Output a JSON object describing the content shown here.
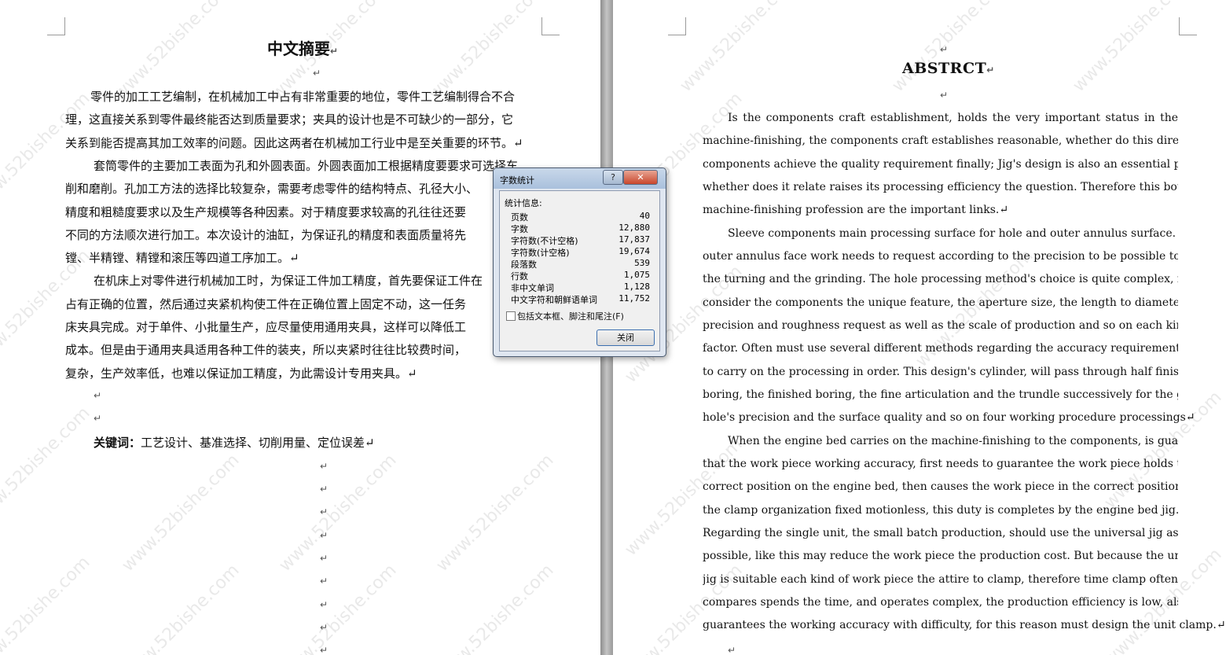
{
  "left_page": {
    "title": "中文摘要",
    "paragraph_mark": "↵",
    "lines": [
      "零件的加工工艺编制，在机械加工中占有非常重要的地位，零件工艺编制得合不合",
      "理，这直接关系到零件最终能否达到质量要求；夹具的设计也是不可缺少的一部分，它",
      "关系到能否提高其加工效率的问题。因此这两者在机械加工行业中是至关重要的环节。↵",
      "套筒零件的主要加工表面为孔和外圆表面。外圆表面加工根据精度要要求可选择车",
      "削和磨削。孔加工方法的选择比较复杂，需要考虑零件的结构特点、孔径大小、",
      "精度和粗糙度要求以及生产规模等各种因素。对于精度要求较高的孔往往还要",
      "不同的方法顺次进行加工。本次设计的油缸，为保证孔的精度和表面质量将先",
      "镗、半精镗、精镗和滚压等四道工序加工。↵",
      "在机床上对零件进行机械加工时，为保证工件加工精度，首先要保证工件在",
      "占有正确的位置，然后通过夹紧机构使工件在正确位置上固定不动，这一任务",
      "床夹具完成。对于单件、小批量生产，应尽量使用通用夹具，这样可以降低工",
      "成本。但是由于通用夹具适用各种工件的装夹，所以夹紧时往往比较费时间，",
      "复杂，生产效率低，也难以保证加工精度，为此需设计专用夹具。↵"
    ],
    "keywords_label": "关键词：",
    "keywords": "工艺设计、基准选择、切削用量、定位误差↵"
  },
  "right_page": {
    "title": "ABSTRCT",
    "lines": [
      "Is the components craft establishment, holds the very important status in the",
      "machine-finishing, the components craft establishes reasonable, whether do this direct relation",
      "components achieve the quality requirement finally; Jig's design is also an essential part,",
      "whether does it relate raises its processing efficiency the question. Therefore this both in the",
      "machine-finishing profession are the important links.↵",
      "Sleeve components main processing surface for hole and outer annulus surface. The",
      "outer annulus face work needs to request according to the precision to be possible to choose",
      "the turning and the grinding. The hole processing method's choice is quite complex, needs to",
      "consider the components the unique feature, the aperture size, the length to diameter ratio, the",
      "precision and roughness request as well as the scale of production and so on each kind of",
      "factor. Often must use several different methods regarding the accuracy requirement high hole",
      "to carry on the processing in order. This design's cylinder, will pass through half finished",
      "boring, the finished boring, the fine articulation and the trundle successively for the guarantee",
      "hole's precision and the surface quality and so on four working procedure processings↵",
      "When the engine bed carries on the machine-finishing to the components, is guaranteed",
      "that the work piece working accuracy, first needs to guarantee the work piece holds the",
      "correct position on the engine bed, then causes the work piece in the correct position through",
      "the clamp organization fixed motionless, this duty is completes by the engine bed jig.",
      "Regarding the single unit, the small batch production, should use the universal jig as far as",
      "possible, like this may reduce the work piece the production cost. But because the universal",
      "jig is suitable each kind of work piece the attire to clamp, therefore time clamp often",
      "compares spends the time, and operates complex, the production efficiency is low, also",
      "guarantees the working accuracy with difficulty, for this reason must design the unit clamp.↵"
    ]
  },
  "watermark": "www.52bishe.com",
  "dialog": {
    "title": "字数统计",
    "help": "?",
    "close_x": "✕",
    "group_label": "统计信息:",
    "stats": [
      {
        "label": "页数",
        "value": "40"
      },
      {
        "label": "字数",
        "value": "12,880"
      },
      {
        "label": "字符数(不计空格)",
        "value": "17,837"
      },
      {
        "label": "字符数(计空格)",
        "value": "19,674"
      },
      {
        "label": "段落数",
        "value": "539"
      },
      {
        "label": "行数",
        "value": "1,075"
      },
      {
        "label": "非中文单词",
        "value": "1,128"
      },
      {
        "label": "中文字符和朝鲜语单词",
        "value": "11,752"
      }
    ],
    "checkbox_label": "包括文本框、脚注和尾注(F)",
    "close_button": "关闭"
  }
}
